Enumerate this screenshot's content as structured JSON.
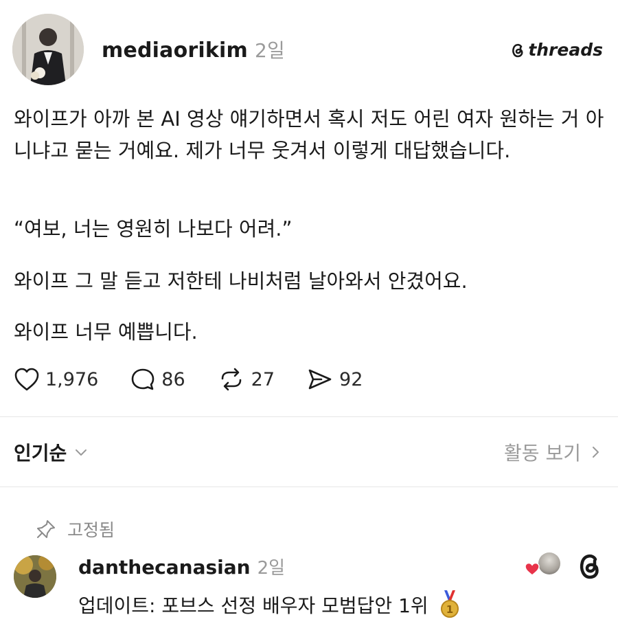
{
  "post": {
    "username": "mediaorikim",
    "time": "2일",
    "brand": "threads",
    "paragraphs": [
      "와이프가 아까 본 AI 영상 얘기하면서 혹시 저도 어린 여자 원하는 거 아니냐고 묻는 거예요. 제가 너무 웃겨서 이렇게 대답했습니다.",
      "“여보, 너는 영원히 나보다 어려.”",
      "와이프 그 말 듣고 저한테 나비처럼 날아와서 안겼어요.",
      "와이프 너무 예쁩니다."
    ],
    "stats": {
      "likes": "1,976",
      "replies": "86",
      "reposts": "27",
      "shares": "92"
    }
  },
  "sort": {
    "label": "인기순",
    "activity_label": "활동 보기"
  },
  "pinned_reply": {
    "pinned_label": "고정됨",
    "username": "danthecanasian",
    "time": "2일",
    "text": "업데이트: 포브스 선정 배우자 모범답안 1위"
  },
  "icons": {
    "like": "heart-icon",
    "reply": "comment-icon",
    "repost": "repost-icon",
    "share": "send-icon",
    "sort_chevron": "chevron-down-icon",
    "activity_chevron": "chevron-right-icon",
    "pin": "pin-icon",
    "medal": "gold-medal-icon",
    "brand": "threads-logo-icon"
  },
  "colors": {
    "text": "#1a1a1a",
    "muted": "#9a9a9a",
    "divider": "#e6e6e6",
    "heart_badge": "#e8334a",
    "medal_gold": "#e0b23a"
  }
}
